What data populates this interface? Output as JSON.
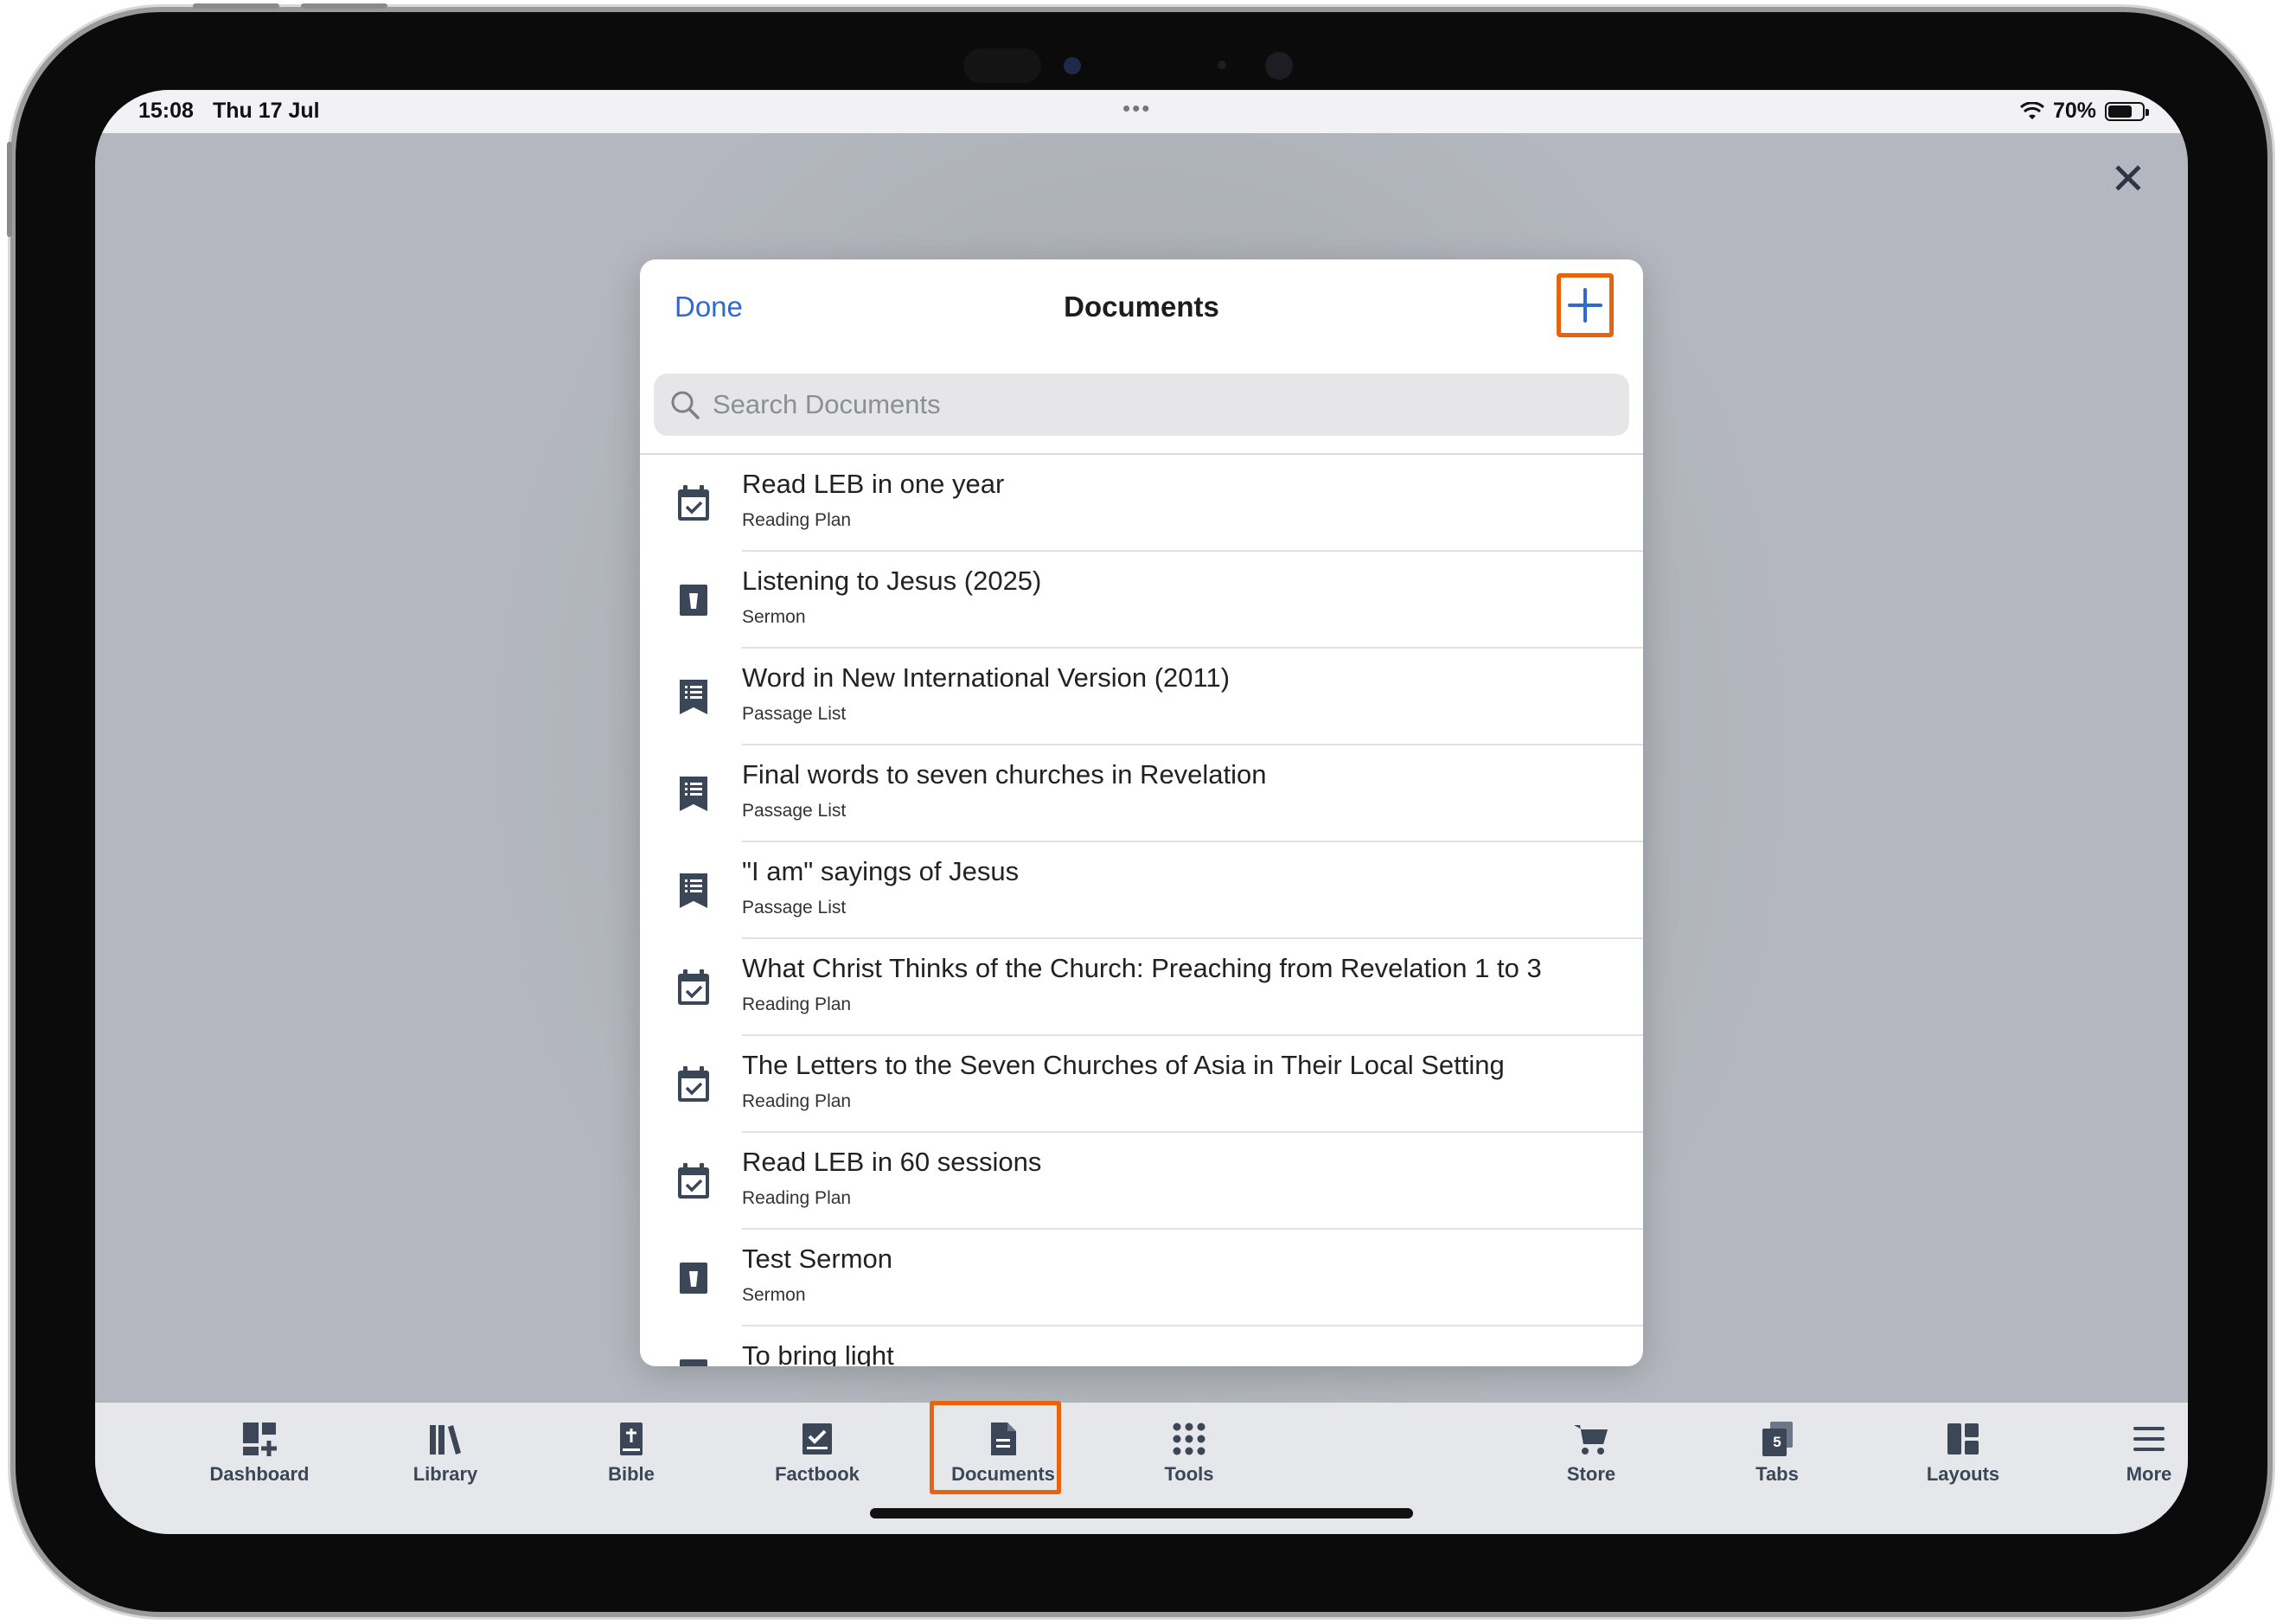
{
  "status_bar": {
    "time": "15:08",
    "date": "Thu 17 Jul",
    "multitask_dots": "•••",
    "battery_percent": "70%",
    "battery_level": 0.7
  },
  "modal": {
    "done_label": "Done",
    "title": "Documents",
    "search_placeholder": "Search Documents",
    "documents": [
      {
        "title": "Read LEB in one year",
        "type": "Reading Plan",
        "icon": "reading-plan-icon"
      },
      {
        "title": "Listening to Jesus (2025)",
        "type": "Sermon",
        "icon": "sermon-icon"
      },
      {
        "title": "Word in New International Version (2011)",
        "type": "Passage List",
        "icon": "passage-list-icon"
      },
      {
        "title": "Final words to seven churches in Revelation",
        "type": "Passage List",
        "icon": "passage-list-icon"
      },
      {
        "title": "\"I am\" sayings of Jesus",
        "type": "Passage List",
        "icon": "passage-list-icon"
      },
      {
        "title": "What Christ Thinks of the Church: Preaching from Revelation 1 to 3",
        "type": "Reading Plan",
        "icon": "reading-plan-icon"
      },
      {
        "title": "The Letters to the Seven Churches of Asia in Their Local Setting",
        "type": "Reading Plan",
        "icon": "reading-plan-icon"
      },
      {
        "title": "Read LEB in 60 sessions",
        "type": "Reading Plan",
        "icon": "reading-plan-icon"
      },
      {
        "title": "Test Sermon",
        "type": "Sermon",
        "icon": "sermon-icon"
      },
      {
        "title": "To bring light",
        "type": "",
        "icon": "sermon-icon"
      }
    ]
  },
  "tabbar": {
    "tabs": [
      {
        "label": "Dashboard",
        "icon": "dashboard-icon"
      },
      {
        "label": "Library",
        "icon": "library-icon"
      },
      {
        "label": "Bible",
        "icon": "bible-icon"
      },
      {
        "label": "Factbook",
        "icon": "factbook-icon"
      },
      {
        "label": "Documents",
        "icon": "documents-icon",
        "active": true
      },
      {
        "label": "Tools",
        "icon": "tools-icon"
      },
      {
        "label": "Store",
        "icon": "store-icon"
      },
      {
        "label": "Tabs",
        "icon": "tabs-icon",
        "badge": "5"
      },
      {
        "label": "Layouts",
        "icon": "layouts-icon"
      },
      {
        "label": "More",
        "icon": "more-icon"
      }
    ]
  },
  "colors": {
    "accent": "#2f6ad0",
    "highlight": "#e8640c",
    "icon": "#3b4657"
  }
}
